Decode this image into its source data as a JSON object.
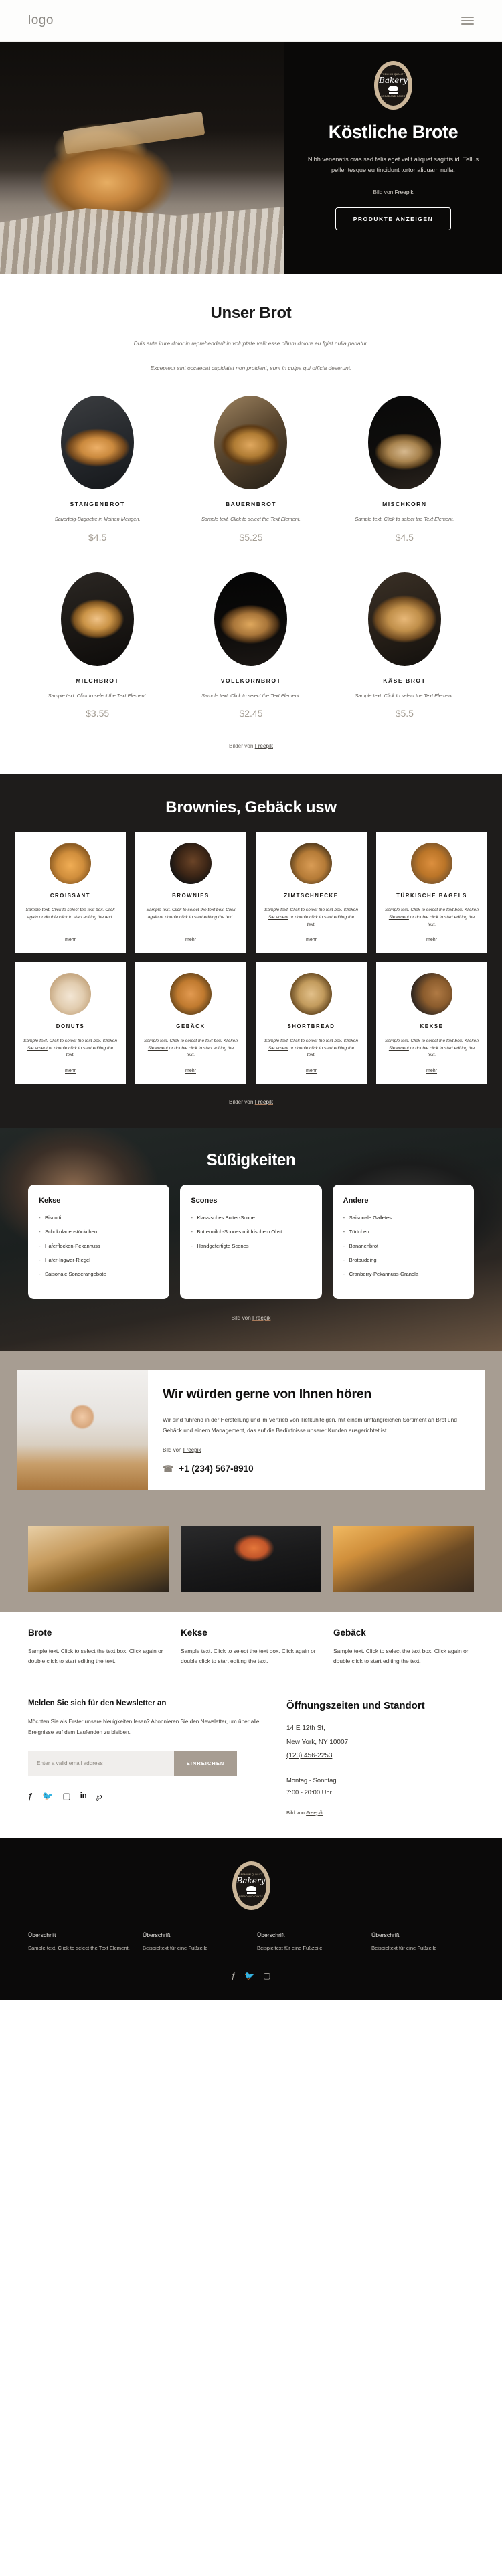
{
  "header": {
    "logo": "logo",
    "menu_icon": "hamburger-icon"
  },
  "hero": {
    "badge": {
      "top": "PREMIUM QUALITY",
      "name": "Bakery",
      "bottom": "BREAD AND CAKES"
    },
    "title": "Köstliche Brote",
    "subtitle": "Nibh venenatis cras sed felis eget velit aliquet sagittis id. Tellus pellentesque eu tincidunt tortor aliquam nulla.",
    "credit_prefix": "Bild von ",
    "credit_link": "Freepik",
    "cta": "PRODUKTE ANZEIGEN"
  },
  "bread": {
    "title": "Unser Brot",
    "lead_line1": "Duis aute irure dolor in reprehenderit in voluptate velit esse cillum dolore eu fgiat nulla pariatur.",
    "lead_line2": "Excepteur sint occaecat cupidatat non proident, sunt in culpa qui officia deserunt.",
    "credit_prefix": "Bilder von ",
    "credit_link": "Freepik",
    "items": [
      {
        "name": "STANGENBROT",
        "desc": "Sauerteig-Baguette in kleinen Mengen.",
        "price": "$4.5"
      },
      {
        "name": "BAUERNBROT",
        "desc": "Sample text. Click to select the Text Element.",
        "price": "$5.25"
      },
      {
        "name": "MISCHKORN",
        "desc": "Sample text. Click to select the Text Element.",
        "price": "$4.5"
      },
      {
        "name": "MILCHBROT",
        "desc": "Sample text. Click to select the Text Element.",
        "price": "$3.55"
      },
      {
        "name": "VOLLKORNBROT",
        "desc": "Sample text. Click to select the Text Element.",
        "price": "$2.45"
      },
      {
        "name": "KÄSE BROT",
        "desc": "Sample text. Click to select the Text Element.",
        "price": "$5.5"
      }
    ]
  },
  "pastry": {
    "title": "Brownies, Gebäck usw",
    "more_label": "mehr",
    "credit_prefix": "Bilder von ",
    "credit_link": "Freepik",
    "items": [
      {
        "name": "CROISSANT",
        "desc_a": "Sample text. Click to select the text box. Click again or double click to start editing the text.",
        "desc_link": "",
        "desc_b": ""
      },
      {
        "name": "BROWNIES",
        "desc_a": "Sample text. Click to select the text box. Click again or double click to start editing the text.",
        "desc_link": "",
        "desc_b": ""
      },
      {
        "name": "ZIMTSCHNECKE",
        "desc_a": "Sample text. Click to select the text box. ",
        "desc_link": "Klicken Sie erneut",
        "desc_b": " or double click to start editing the text."
      },
      {
        "name": "TÜRKISCHE BAGELS",
        "desc_a": "Sample text. Click to select the text box. ",
        "desc_link": "Klicken Sie erneut",
        "desc_b": " or double click to start editing the text."
      },
      {
        "name": "DONUTS",
        "desc_a": "Sample text. Click to select the text box. ",
        "desc_link": "Klicken Sie erneut",
        "desc_b": " or double click to start editing the text."
      },
      {
        "name": "GEBÄCK",
        "desc_a": "Sample text. Click to select the text box. ",
        "desc_link": "Klicken Sie erneut",
        "desc_b": " or double click to start editing the text."
      },
      {
        "name": "SHORTBREAD",
        "desc_a": "Sample text. Click to select the text box. ",
        "desc_link": "Klicken Sie erneut",
        "desc_b": " or double click to start editing the text."
      },
      {
        "name": "KEKSE",
        "desc_a": "Sample text. Click to select the text box. ",
        "desc_link": "Klicken Sie erneut",
        "desc_b": " or double click to start editing the text."
      }
    ]
  },
  "sweets": {
    "title": "Süßigkeiten",
    "credit_prefix": "Bild von ",
    "credit_link": "Freepik",
    "columns": [
      {
        "title": "Kekse",
        "items": [
          "Biscotti",
          "Schokoladenstückchen",
          "Haferflocken-Pekannuss",
          "Hafer-Ingwer-Riegel",
          "Saisonale Sonderangebote"
        ]
      },
      {
        "title": "Scones",
        "items": [
          "Klassisches Butter-Scone",
          "Buttermilch-Scones mit frischem Obst",
          "Handgefertigte Scones"
        ]
      },
      {
        "title": "Andere",
        "items": [
          "Saisonale Galletes",
          "Törtchen",
          "Bananenbrot",
          "Brotpudding",
          "Cranberry-Pekannuss-Granola"
        ]
      }
    ]
  },
  "contact": {
    "title": "Wir würden gerne von Ihnen hören",
    "text": "Wir sind führend in der Herstellung und im Vertrieb von Tiefkühlteigen, mit einem umfangreichen Sortiment an Brot und Gebäck und einem Management, das auf die Bedürfnisse unserer Kunden ausgerichtet ist.",
    "credit_prefix": "Bild von ",
    "credit_link": "Freepik",
    "phone_icon": "phone-icon",
    "phone": "+1 (234) 567-8910"
  },
  "gallery": {
    "items": [
      {
        "title": "Brote",
        "desc": "Sample text. Click to select the text box. Click again or double click to start editing the text."
      },
      {
        "title": "Kekse",
        "desc": "Sample text. Click to select the text box. Click again or double click to start editing the text."
      },
      {
        "title": "Gebäck",
        "desc": "Sample text. Click to select the text box. Click again or double click to start editing the text."
      }
    ]
  },
  "newsletter": {
    "title": "Melden Sie sich für den Newsletter an",
    "text": "Möchten Sie als Erster unsere Neuigkeiten lesen? Abonnieren Sie den Newsletter, um über alle Ereignisse auf dem Laufenden zu bleiben.",
    "placeholder": "Enter a valid email address",
    "value": "",
    "submit": "EINREICHEN",
    "socials": [
      "facebook-icon",
      "twitter-icon",
      "instagram-icon",
      "linkedin-icon",
      "pinterest-icon"
    ]
  },
  "hours": {
    "title": "Öffnungszeiten und Standort",
    "address_line1": "14 E 12th St,",
    "address_line2": "New York, NY 10007",
    "phone": "(123) 456-2253",
    "days": "Montag - Sonntag",
    "time": "7:00 - 20:00 Uhr",
    "credit_prefix": "Bild von ",
    "credit_link": "Freepik"
  },
  "footer": {
    "badge": {
      "top": "PREMIUM QUALITY",
      "name": "Bakery",
      "bottom": "BREAD AND CAKES"
    },
    "columns": [
      {
        "title": "Überschrift",
        "text": "Sample text. Click to select the Text Element."
      },
      {
        "title": "Überschrift",
        "text": "Beispieltext für eine Fußzeile"
      },
      {
        "title": "Überschrift",
        "text": "Beispieltext für eine Fußzeile"
      },
      {
        "title": "Überschrift",
        "text": "Beispieltext für eine Fußzeile"
      }
    ],
    "socials": [
      "facebook-icon",
      "twitter-icon",
      "instagram-icon"
    ]
  },
  "colors": {
    "accent": "#a79d92",
    "dark": "#1e1c1b",
    "black": "#0b0a0a"
  }
}
